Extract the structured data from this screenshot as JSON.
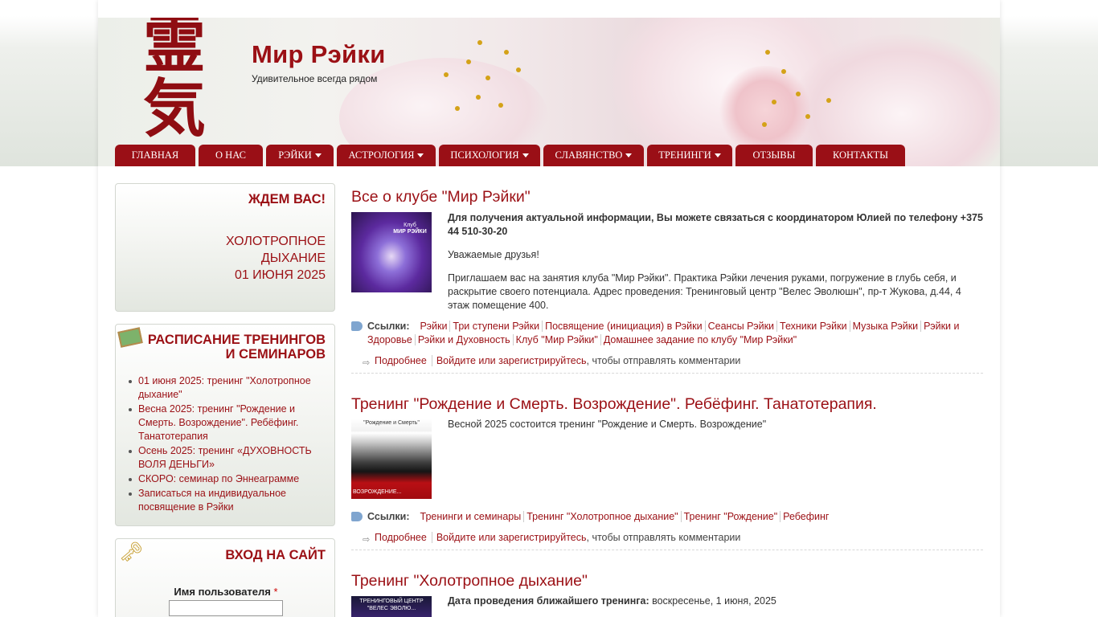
{
  "site": {
    "logo_glyphs": "霊気",
    "name": "Мир Рэйки",
    "slogan": "Удивительное всегда рядом"
  },
  "nav": [
    {
      "label": "ГЛАВНАЯ",
      "dropdown": false
    },
    {
      "label": "О НАС",
      "dropdown": false
    },
    {
      "label": "РЭЙКИ",
      "dropdown": true
    },
    {
      "label": "АСТРОЛОГИЯ",
      "dropdown": true
    },
    {
      "label": "ПСИХОЛОГИЯ",
      "dropdown": true
    },
    {
      "label": "СЛАВЯНСТВО",
      "dropdown": true
    },
    {
      "label": "ТРЕНИНГИ",
      "dropdown": true
    },
    {
      "label": "ОТЗЫВЫ",
      "dropdown": false
    },
    {
      "label": "КОНТАКТЫ",
      "dropdown": false
    }
  ],
  "sidebar": {
    "wait": {
      "title": "ЖДЕМ ВАС!",
      "line1": "ХОЛОТРОПНОЕ",
      "line2": "ДЫХАНИЕ",
      "line3": "01 ИЮНЯ 2025"
    },
    "schedule": {
      "title_line1": "РАСПИСАНИЕ ТРЕНИНГОВ",
      "title_line2": "И СЕМИНАРОВ",
      "items": [
        "01 июня 2025: тренинг \"Холотропное дыхание\"",
        "Весна 2025: тренинг \"Рождение и Смерть. Возрождение\". Ребёфинг. Танатотерапия",
        "Осень 2025: тренинг «ДУХОВНОСТЬ ВОЛЯ ДЕНЬГИ»",
        "СКОРО: семинар по Эннеаграмме",
        "Записаться на индивидуальное посвящение в Рэйки"
      ]
    },
    "login": {
      "title": "ВХОД НА САЙТ",
      "username_label": "Имя пользователя",
      "required_mark": "*"
    }
  },
  "nodes": [
    {
      "title": "Все о клубе \"Мир Рэйки\"",
      "thumb_text_1": "Клуб",
      "thumb_text_2": "МИР РЭЙКИ",
      "lead": "Для получения актуальной информации, Вы можете связаться с координатором Юлией по телефону +375 44 510-30-20",
      "p1": "Уважаемые друзья!",
      "p2": "Приглашаем вас на занятия клуба \"Мир Рэйки\". Практика Рэйки лечения руками, погружение в глубь себя, и раскрытие своего потенциала. Адрес проведения: Тренинговый центр \"Велес Эволюшн\", пр-т Жукова, д.44, 4 этаж помещение 400.",
      "links_label": "Ссылки:",
      "terms": [
        "Рэйки",
        "Три ступени Рэйки",
        "Посвящение (инициация) в Рэйки",
        "Сеансы Рэйки",
        "Техники Рэйки",
        "Музыка Рэйки",
        "Рэйки и Здоровье",
        "Рэйки и Духовность",
        "Клуб \"Мир Рэйки\"",
        "Домашнее задание по клубу \"Мир Рэйки\""
      ],
      "more": "Подробнее",
      "login_link": "Войдите или зарегистрируйтесь",
      "login_suffix": ", чтобы отправлять комментарии"
    },
    {
      "title": "Тренинг \"Рождение и Смерть. Возрождение\". Ребёфинг. Танатотерапия.",
      "thumb_text_1": "\"Рождение     и     Смерть\"",
      "thumb_text_2": "ВОЗРОЖДЕНИЕ...",
      "body": "Весной 2025 состоится тренинг \"Рождение и Смерть. Возрождение\"",
      "links_label": "Ссылки:",
      "terms": [
        "Тренинги и семинары",
        "Тренинг \"Холотропное дыхание\"",
        "Тренинг \"Рождение\"",
        "Ребефинг"
      ],
      "more": "Подробнее",
      "login_link": "Войдите или зарегистрируйтесь",
      "login_suffix": ", чтобы отправлять комментарии"
    },
    {
      "title": "Тренинг \"Холотропное дыхание\"",
      "thumb_text_1": "ТРЕНИНГОВЫЙ ЦЕНТР",
      "thumb_text_2": "\"ВЕЛЕС ЭВОЛЮ...",
      "date_label": "Дата проведения ближайшего тренинга:",
      "date_value": " воскресенье, 1 июня, 2025"
    }
  ],
  "colors": {
    "brand": "#9b1015",
    "nav_bg": "#9a0f16"
  }
}
